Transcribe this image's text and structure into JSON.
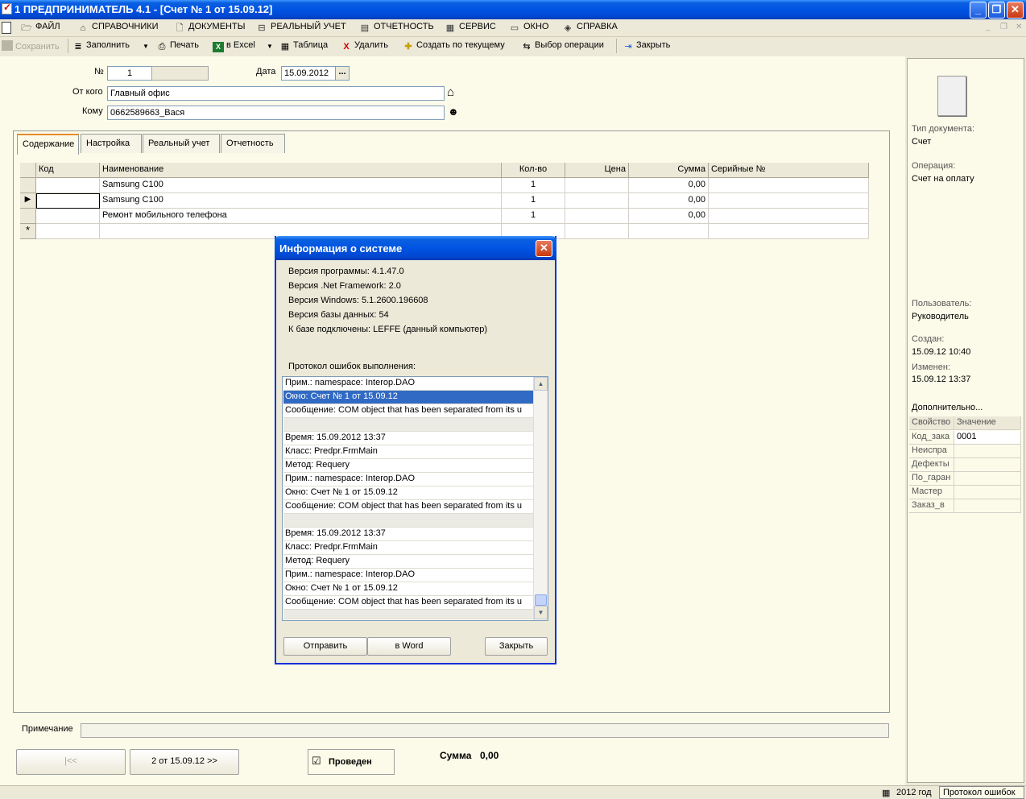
{
  "window": {
    "title": "1  ПРЕДПРИНИМАТЕЛЬ 4.1 - [Счет № 1 от 15.09.12]",
    "minimize": "_",
    "restore": "❐",
    "close": "✕"
  },
  "menu": {
    "items": [
      {
        "label": "ФАЙЛ",
        "icon": "folder-icon"
      },
      {
        "label": "СПРАВОЧНИКИ",
        "icon": "home-icon"
      },
      {
        "label": "ДОКУМЕНТЫ",
        "icon": "document-icon"
      },
      {
        "label": "РЕАЛЬНЫЙ УЧЕТ",
        "icon": "ledger-icon"
      },
      {
        "label": "ОТЧЕТНОСТЬ",
        "icon": "report-icon"
      },
      {
        "label": "СЕРВИС",
        "icon": "calculator-icon"
      },
      {
        "label": "ОКНО",
        "icon": "window-icon"
      },
      {
        "label": "СПРАВКА",
        "icon": "help-icon"
      }
    ]
  },
  "toolbar": {
    "save": "Сохранить",
    "fill": "Заполнить",
    "print": "Печать",
    "excel": "в Excel",
    "table": "Таблица",
    "delete": "Удалить",
    "create_from": "Создать по текущему",
    "select_op": "Выбор операции",
    "close": "Закрыть"
  },
  "form": {
    "number_label": "№",
    "number_value": "1",
    "date_label": "Дата",
    "date_value": "15.09.2012",
    "date_btn": "...",
    "from_label": "От кого",
    "from_value": "Главный офис",
    "to_label": "Кому",
    "to_value": "0662589663_Вася"
  },
  "tabs": [
    "Содержание",
    "Настройка",
    "Реальный учет",
    "Отчетность"
  ],
  "grid": {
    "headers": [
      "Код",
      "Наименование",
      "Кол-во",
      "Цена",
      "Сумма",
      "Серийные №"
    ],
    "rows": [
      {
        "code": "",
        "name": "Samsung C100",
        "qty": "1",
        "price": "",
        "sum": "0,00",
        "serial": ""
      },
      {
        "code": "",
        "name": "Samsung C100",
        "qty": "1",
        "price": "",
        "sum": "0,00",
        "serial": ""
      },
      {
        "code": "",
        "name": "Ремонт мобильного телефона",
        "qty": "1",
        "price": "",
        "sum": "0,00",
        "serial": ""
      }
    ],
    "new_row_marker": "*",
    "current_marker": "▶"
  },
  "bottom": {
    "note_label": "Примечание",
    "first_btn": "|<<",
    "next_btn": "2 от 15.09.12 >>",
    "posted_label": "Проведен",
    "posted_check": "☑",
    "sum_label": "Сумма",
    "sum_value": "0,00"
  },
  "info_panel": {
    "doc_type_label": "Тип документа:",
    "doc_type_value": "Счет",
    "operation_label": "Операция:",
    "operation_value": "Счет на оплату",
    "user_label": "Пользователь:",
    "user_value": "Руководитель",
    "created_label": "Создан:",
    "created_value": "15.09.12  10:40",
    "modified_label": "Изменен:",
    "modified_value": "15.09.12  13:37",
    "extra_label": "Дополнительно...",
    "props_headers": [
      "Свойство",
      "Значение"
    ],
    "props": [
      {
        "name": "Код_зака",
        "value": "0001"
      },
      {
        "name": "Неиспра",
        "value": ""
      },
      {
        "name": "Дефекты",
        "value": ""
      },
      {
        "name": "По_гаран",
        "value": ""
      },
      {
        "name": "Мастер",
        "value": ""
      },
      {
        "name": "Заказ_в",
        "value": ""
      }
    ]
  },
  "statusbar": {
    "year": "2012 год",
    "errors": "Протокол ошибок"
  },
  "dialog": {
    "title": "Информация о системе",
    "close": "✕",
    "lines": [
      "Версия программы: 4.1.47.0",
      "Версия .Net Framework: 2.0",
      "Версия Windows: 5.1.2600.196608",
      "Версия базы данных: 54",
      "К базе подключены: LEFFE (данный компьютер)"
    ],
    "log_label": "Протокол ошибок выполнения:",
    "log": [
      "Прим.: namespace: Interop.DAO",
      "Окно: Счет № 1 от 15.09.12",
      "Сообщение: COM object that has been separated from its u",
      "",
      "Время: 15.09.2012  13:37",
      "Класс: Predpr.FrmMain",
      "Метод: Requery",
      "Прим.: namespace: Interop.DAO",
      "Окно: Счет № 1 от 15.09.12",
      "Сообщение: COM object that has been separated from its u",
      "",
      "Время: 15.09.2012  13:37",
      "Класс: Predpr.FrmMain",
      "Метод: Requery",
      "Прим.: namespace: Interop.DAO",
      "Окно: Счет № 1 от 15.09.12",
      "Сообщение: COM object that has been separated from its u",
      ""
    ],
    "send_btn": "Отправить",
    "word_btn": "в Word",
    "close_btn": "Закрыть"
  }
}
